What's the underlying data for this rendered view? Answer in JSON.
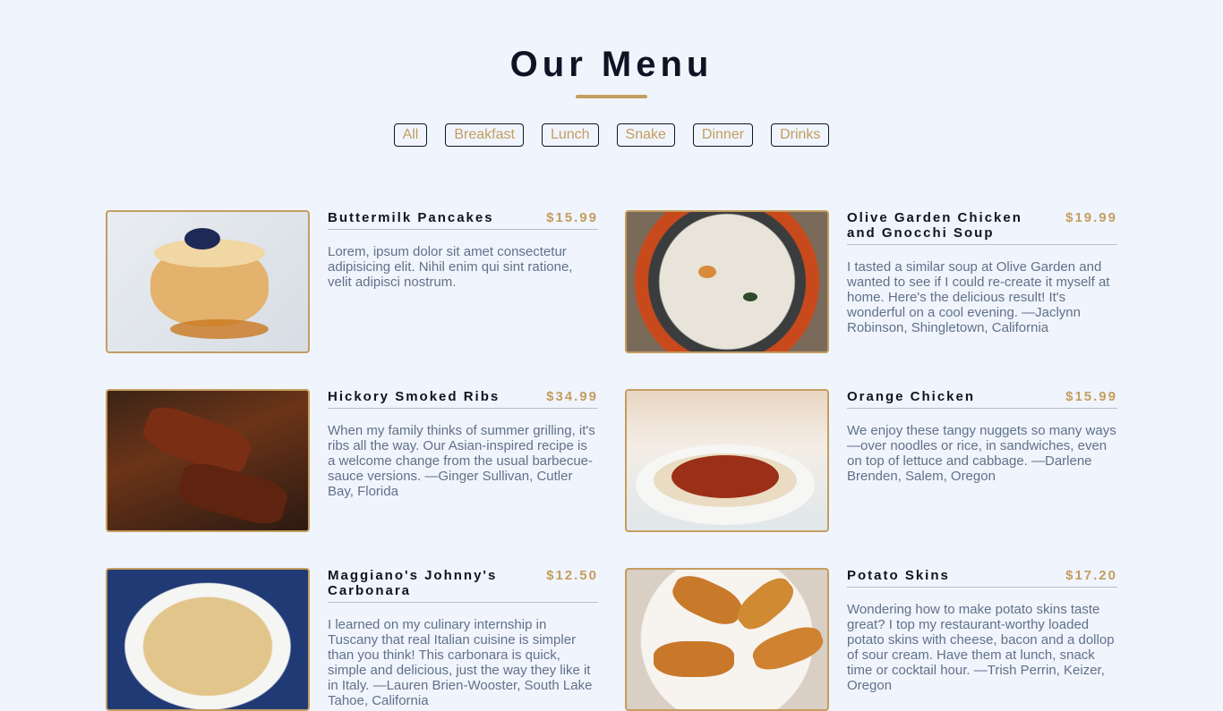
{
  "page": {
    "title": "Our Menu"
  },
  "filters": [
    "All",
    "Breakfast",
    "Lunch",
    "Snake",
    "Dinner",
    "Drinks"
  ],
  "colors": {
    "background": "#f0f5fd",
    "accent": "#c59d5f",
    "heading": "#0d1524",
    "text": "#617089"
  },
  "menu": [
    {
      "name": "Buttermilk Pancakes",
      "price": "$15.99",
      "desc": "Lorem, ipsum dolor sit amet consectetur adipisicing elit. Nihil enim qui sint ratione, velit adipisci nostrum."
    },
    {
      "name": "Olive Garden Chicken and Gnocchi Soup",
      "price": "$19.99",
      "desc": "I tasted a similar soup at Olive Garden and wanted to see if I could re-create it myself at home. Here's the delicious result! It's wonderful on a cool evening. —Jaclynn Robinson, Shingletown, California"
    },
    {
      "name": "Hickory Smoked Ribs",
      "price": "$34.99",
      "desc": "When my family thinks of summer grilling, it's ribs all the way. Our Asian-inspired recipe is a welcome change from the usual barbecue-sauce versions. —Ginger Sullivan, Cutler Bay, Florida"
    },
    {
      "name": "Orange Chicken",
      "price": "$15.99",
      "desc": "We enjoy these tangy nuggets so many ways—over noodles or rice, in sandwiches, even on top of lettuce and cabbage. —Darlene Brenden, Salem, Oregon"
    },
    {
      "name": "Maggiano's Johnny's Carbonara",
      "price": "$12.50",
      "desc": "I learned on my culinary internship in Tuscany that real Italian cuisine is simpler than you think! This carbonara is quick, simple and delicious, just the way they like it in Italy. —Lauren Brien-Wooster, South Lake Tahoe, California"
    },
    {
      "name": "Potato Skins",
      "price": "$17.20",
      "desc": "Wondering how to make potato skins taste great? I top my restaurant-worthy loaded potato skins with cheese, bacon and a dollop of sour cream. Have them at lunch, snack time or cocktail hour. —Trish Perrin, Keizer, Oregon"
    }
  ]
}
